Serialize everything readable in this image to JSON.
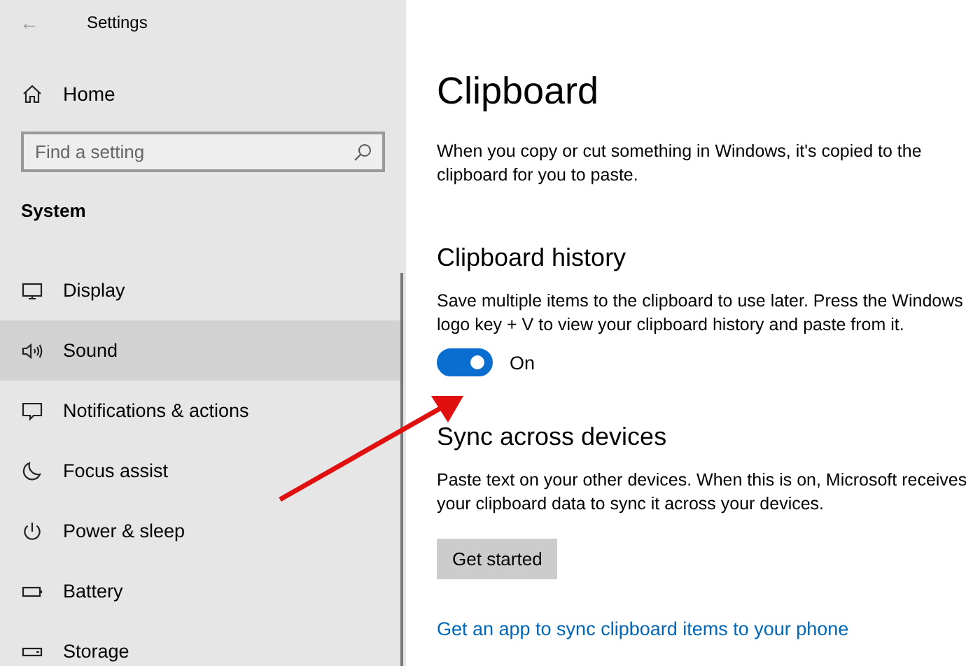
{
  "window": {
    "title": "Settings",
    "back": "←"
  },
  "sidebar": {
    "home": "Home",
    "search": {
      "placeholder": "Find a setting"
    },
    "section": "System",
    "items": [
      {
        "label": "Display",
        "kind": "display",
        "selected": false
      },
      {
        "label": "Sound",
        "kind": "sound",
        "selected": true
      },
      {
        "label": "Notifications & actions",
        "kind": "notifications",
        "selected": false
      },
      {
        "label": "Focus assist",
        "kind": "focus",
        "selected": false
      },
      {
        "label": "Power & sleep",
        "kind": "power",
        "selected": false
      },
      {
        "label": "Battery",
        "kind": "battery",
        "selected": false
      },
      {
        "label": "Storage",
        "kind": "storage",
        "selected": false
      }
    ]
  },
  "content": {
    "title": "Clipboard",
    "intro": "When you copy or cut something in Windows, it's copied to the clipboard for you to paste.",
    "history": {
      "heading": "Clipboard history",
      "text": "Save multiple items to the clipboard to use later. Press the Windows logo key + V to view your clipboard history and paste from it.",
      "toggle": {
        "on": true,
        "label": "On"
      }
    },
    "sync": {
      "heading": "Sync across devices",
      "text": "Paste text on your other devices. When this is on, Microsoft receives your clipboard data to sync it across your devices.",
      "button": "Get started"
    },
    "link": "Get an app to sync clipboard items to your phone"
  }
}
